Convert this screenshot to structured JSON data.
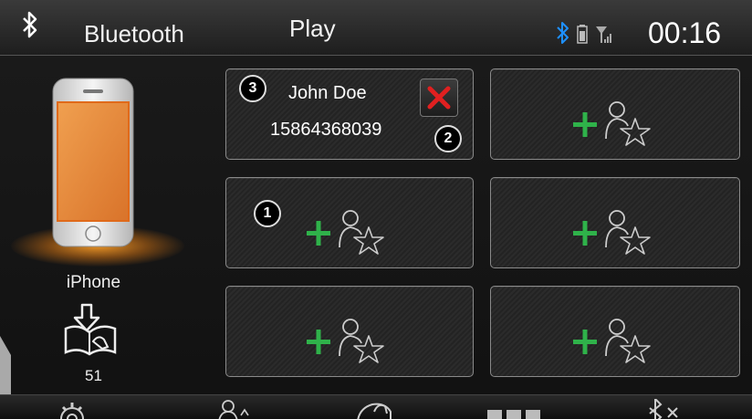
{
  "header": {
    "title": "Bluetooth",
    "tab": "Play",
    "time": "00:16",
    "icons": [
      "bluetooth-icon",
      "battery-icon",
      "signal-icon"
    ],
    "accent": "#1e90ff"
  },
  "device": {
    "name": "iPhone",
    "contacts_count": "51",
    "glow_color": "#ff9f28"
  },
  "favourites": {
    "filled": {
      "name": "John Doe",
      "number": "15864368039",
      "delete_color": "#e02020"
    },
    "add_color": "#2fb24a"
  },
  "callouts": [
    "1",
    "2",
    "3"
  ],
  "bottom_nav": [
    "settings-icon",
    "contacts-icon",
    "call-log-icon",
    "dialpad-icon",
    "bluetooth-off-icon"
  ]
}
